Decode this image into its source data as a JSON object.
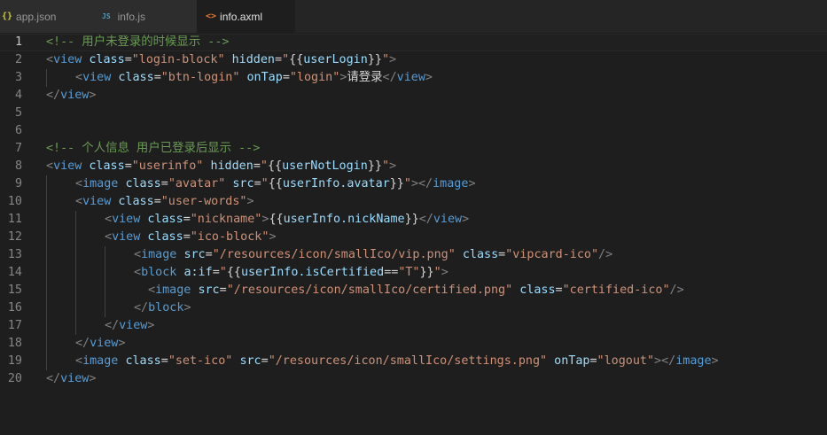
{
  "tabs": [
    {
      "icon": "{}",
      "icon_type": "json",
      "label": "app.json",
      "active": false
    },
    {
      "icon": "JS",
      "icon_type": "js",
      "label": "info.js",
      "active": false
    },
    {
      "icon": "<>",
      "icon_type": "xml",
      "label": "info.axml",
      "active": true
    }
  ],
  "editor": {
    "current_line": 1,
    "lines": [
      {
        "n": "1",
        "indent": 0,
        "tokens": [
          [
            "comment",
            "<!-- 用户未登录的时候显示 -->"
          ]
        ]
      },
      {
        "n": "2",
        "indent": 0,
        "tokens": [
          [
            "punct",
            "<"
          ],
          [
            "tag",
            "view"
          ],
          [
            "text",
            " "
          ],
          [
            "attr",
            "class"
          ],
          [
            "text",
            "="
          ],
          [
            "str",
            "\"login-block\""
          ],
          [
            "text",
            " "
          ],
          [
            "attr",
            "hidden"
          ],
          [
            "text",
            "="
          ],
          [
            "str",
            "\""
          ],
          [
            "text",
            "{{"
          ],
          [
            "attr",
            "userLogin"
          ],
          [
            "text",
            "}}"
          ],
          [
            "str",
            "\""
          ],
          [
            "punct",
            ">"
          ]
        ]
      },
      {
        "n": "3",
        "indent": 1,
        "tokens": [
          [
            "punct",
            "<"
          ],
          [
            "tag",
            "view"
          ],
          [
            "text",
            " "
          ],
          [
            "attr",
            "class"
          ],
          [
            "text",
            "="
          ],
          [
            "str",
            "\"btn-login\""
          ],
          [
            "text",
            " "
          ],
          [
            "attr",
            "onTap"
          ],
          [
            "text",
            "="
          ],
          [
            "str",
            "\"login\""
          ],
          [
            "punct",
            ">"
          ],
          [
            "text",
            "请登录"
          ],
          [
            "punct",
            "</"
          ],
          [
            "tag",
            "view"
          ],
          [
            "punct",
            ">"
          ]
        ]
      },
      {
        "n": "4",
        "indent": 0,
        "tokens": [
          [
            "punct",
            "</"
          ],
          [
            "tag",
            "view"
          ],
          [
            "punct",
            ">"
          ]
        ]
      },
      {
        "n": "5",
        "indent": 0,
        "tokens": []
      },
      {
        "n": "6",
        "indent": 0,
        "tokens": []
      },
      {
        "n": "7",
        "indent": 0,
        "tokens": [
          [
            "comment",
            "<!-- 个人信息 用户已登录后显示 -->"
          ]
        ]
      },
      {
        "n": "8",
        "indent": 0,
        "tokens": [
          [
            "punct",
            "<"
          ],
          [
            "tag",
            "view"
          ],
          [
            "text",
            " "
          ],
          [
            "attr",
            "class"
          ],
          [
            "text",
            "="
          ],
          [
            "str",
            "\"userinfo\""
          ],
          [
            "text",
            " "
          ],
          [
            "attr",
            "hidden"
          ],
          [
            "text",
            "="
          ],
          [
            "str",
            "\""
          ],
          [
            "text",
            "{{"
          ],
          [
            "attr",
            "userNotLogin"
          ],
          [
            "text",
            "}}"
          ],
          [
            "str",
            "\""
          ],
          [
            "punct",
            ">"
          ]
        ]
      },
      {
        "n": "9",
        "indent": 1,
        "tokens": [
          [
            "punct",
            "<"
          ],
          [
            "tag",
            "image"
          ],
          [
            "text",
            " "
          ],
          [
            "attr",
            "class"
          ],
          [
            "text",
            "="
          ],
          [
            "str",
            "\"avatar\""
          ],
          [
            "text",
            " "
          ],
          [
            "attr",
            "src"
          ],
          [
            "text",
            "="
          ],
          [
            "str",
            "\""
          ],
          [
            "text",
            "{{"
          ],
          [
            "attr",
            "userInfo.avatar"
          ],
          [
            "text",
            "}}"
          ],
          [
            "str",
            "\""
          ],
          [
            "punct",
            "></"
          ],
          [
            "tag",
            "image"
          ],
          [
            "punct",
            ">"
          ]
        ]
      },
      {
        "n": "10",
        "indent": 1,
        "tokens": [
          [
            "punct",
            "<"
          ],
          [
            "tag",
            "view"
          ],
          [
            "text",
            " "
          ],
          [
            "attr",
            "class"
          ],
          [
            "text",
            "="
          ],
          [
            "str",
            "\"user-words\""
          ],
          [
            "punct",
            ">"
          ]
        ]
      },
      {
        "n": "11",
        "indent": 2,
        "tokens": [
          [
            "punct",
            "<"
          ],
          [
            "tag",
            "view"
          ],
          [
            "text",
            " "
          ],
          [
            "attr",
            "class"
          ],
          [
            "text",
            "="
          ],
          [
            "str",
            "\"nickname\""
          ],
          [
            "punct",
            ">"
          ],
          [
            "text",
            "{{"
          ],
          [
            "attr",
            "userInfo.nickName"
          ],
          [
            "text",
            "}}"
          ],
          [
            "punct",
            "</"
          ],
          [
            "tag",
            "view"
          ],
          [
            "punct",
            ">"
          ]
        ]
      },
      {
        "n": "12",
        "indent": 2,
        "tokens": [
          [
            "punct",
            "<"
          ],
          [
            "tag",
            "view"
          ],
          [
            "text",
            " "
          ],
          [
            "attr",
            "class"
          ],
          [
            "text",
            "="
          ],
          [
            "str",
            "\"ico-block\""
          ],
          [
            "punct",
            ">"
          ]
        ]
      },
      {
        "n": "13",
        "indent": 3,
        "tokens": [
          [
            "punct",
            "<"
          ],
          [
            "tag",
            "image"
          ],
          [
            "text",
            " "
          ],
          [
            "attr",
            "src"
          ],
          [
            "text",
            "="
          ],
          [
            "str",
            "\"/resources/icon/smallIco/vip.png\""
          ],
          [
            "text",
            " "
          ],
          [
            "attr",
            "class"
          ],
          [
            "text",
            "="
          ],
          [
            "str",
            "\"vipcard-ico\""
          ],
          [
            "punct",
            "/>"
          ]
        ]
      },
      {
        "n": "14",
        "indent": 3,
        "tokens": [
          [
            "punct",
            "<"
          ],
          [
            "tag",
            "block"
          ],
          [
            "text",
            " "
          ],
          [
            "attr",
            "a:if"
          ],
          [
            "text",
            "="
          ],
          [
            "str",
            "\""
          ],
          [
            "text",
            "{{"
          ],
          [
            "attr",
            "userInfo.isCertified"
          ],
          [
            "text",
            "=="
          ],
          [
            "str",
            "\"T\""
          ],
          [
            "text",
            "}}"
          ],
          [
            "str",
            "\""
          ],
          [
            "punct",
            ">"
          ]
        ]
      },
      {
        "n": "15",
        "indent": 3,
        "extra": 16,
        "tokens": [
          [
            "punct",
            "<"
          ],
          [
            "tag",
            "image"
          ],
          [
            "text",
            " "
          ],
          [
            "attr",
            "src"
          ],
          [
            "text",
            "="
          ],
          [
            "str",
            "\"/resources/icon/smallIco/certified.png\""
          ],
          [
            "text",
            " "
          ],
          [
            "attr",
            "class"
          ],
          [
            "text",
            "="
          ],
          [
            "str",
            "\"certified-ico\""
          ],
          [
            "punct",
            "/>"
          ]
        ]
      },
      {
        "n": "16",
        "indent": 3,
        "tokens": [
          [
            "punct",
            "</"
          ],
          [
            "tag",
            "block"
          ],
          [
            "punct",
            ">"
          ]
        ]
      },
      {
        "n": "17",
        "indent": 2,
        "tokens": [
          [
            "punct",
            "</"
          ],
          [
            "tag",
            "view"
          ],
          [
            "punct",
            ">"
          ]
        ]
      },
      {
        "n": "18",
        "indent": 1,
        "tokens": [
          [
            "punct",
            "</"
          ],
          [
            "tag",
            "view"
          ],
          [
            "punct",
            ">"
          ]
        ]
      },
      {
        "n": "19",
        "indent": 1,
        "tokens": [
          [
            "punct",
            "<"
          ],
          [
            "tag",
            "image"
          ],
          [
            "text",
            " "
          ],
          [
            "attr",
            "class"
          ],
          [
            "text",
            "="
          ],
          [
            "str",
            "\"set-ico\""
          ],
          [
            "text",
            " "
          ],
          [
            "attr",
            "src"
          ],
          [
            "text",
            "="
          ],
          [
            "str",
            "\"/resources/icon/smallIco/settings.png\""
          ],
          [
            "text",
            " "
          ],
          [
            "attr",
            "onTap"
          ],
          [
            "text",
            "="
          ],
          [
            "str",
            "\"logout\""
          ],
          [
            "punct",
            "></"
          ],
          [
            "tag",
            "image"
          ],
          [
            "punct",
            ">"
          ]
        ]
      },
      {
        "n": "20",
        "indent": 0,
        "tokens": [
          [
            "punct",
            "</"
          ],
          [
            "tag",
            "view"
          ],
          [
            "punct",
            ">"
          ]
        ]
      }
    ]
  }
}
